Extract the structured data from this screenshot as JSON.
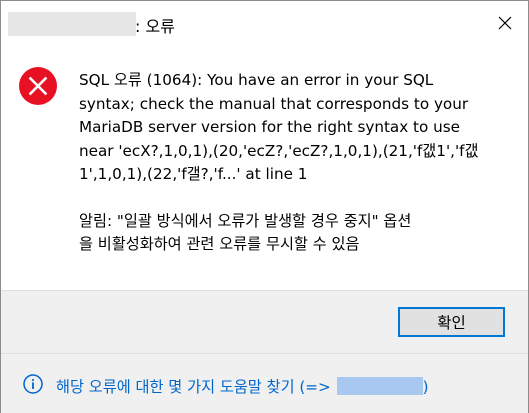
{
  "window": {
    "title": ": 오류"
  },
  "message": {
    "lines": [
      "SQL 오류 (1064): You have an error in your SQL",
      "syntax; check the manual that corresponds to your",
      "MariaDB server version for the right syntax to use",
      "near 'ecX?,1,0,1),(20,'ecZ?,'ecZ?,1,0,1),(21,'f갮1','f갮",
      "1',1,0,1),(22,'f갤?,'f...' at line 1"
    ],
    "notice_lines": [
      "알림: \"일괄 방식에서 오류가 발생할 경우 중지\" 옵션",
      "을 비활성화하여 관련 오류를 무시할 수 있음"
    ]
  },
  "buttons": {
    "ok_label": "확인"
  },
  "footer": {
    "link_text": "해당 오류에 대한 몇 가지 도움말 찾기 (=>",
    "link_suffix": ")"
  },
  "colors": {
    "error_red": "#e81123",
    "info_blue": "#0066cc",
    "button_focus": "#0078d7"
  },
  "icons": {
    "title": "close-icon",
    "message": "error-icon",
    "footer": "info-icon"
  }
}
